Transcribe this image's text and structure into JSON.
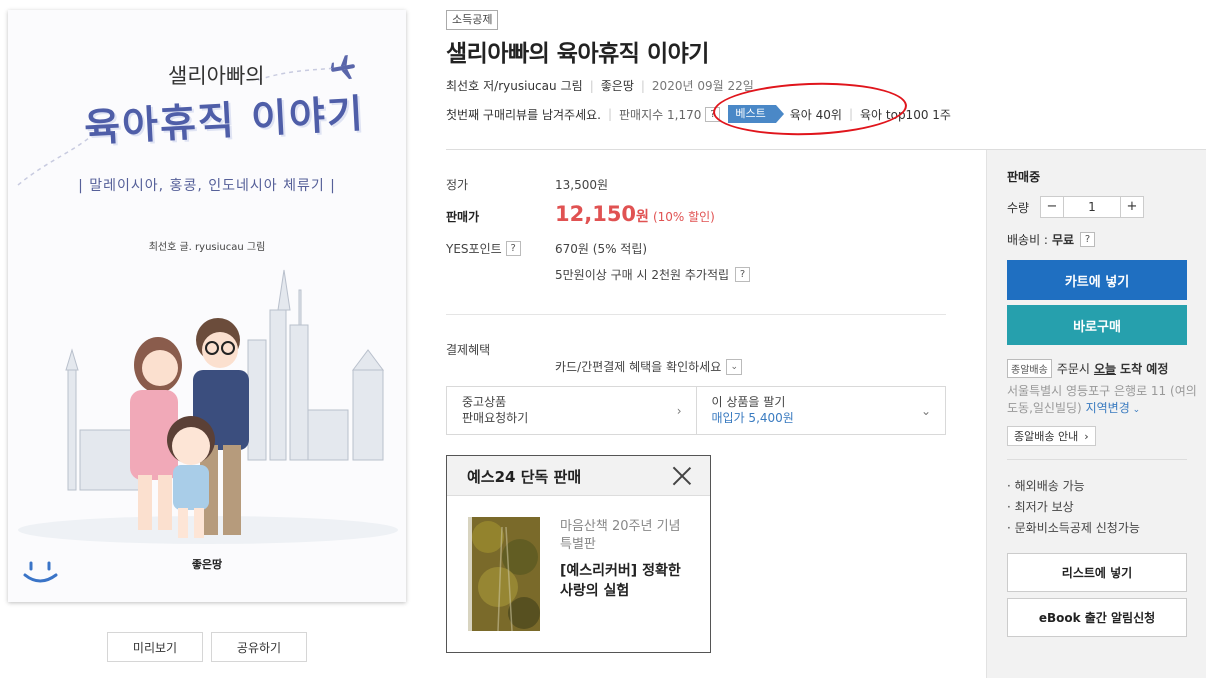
{
  "cover": {
    "subtitle_top": "샐리아빠의",
    "main_title": "육아휴직 이야기",
    "tagline": "| 말레이시아, 홍콩, 인도네시아 체류기 |",
    "authors": "최선호 글. ryusiucau 그림",
    "publisher_logo": "좋은땅"
  },
  "cover_buttons": {
    "preview": "미리보기",
    "share": "공유하기"
  },
  "product": {
    "badge": "소득공제",
    "title": "샐리아빠의 육아휴직 이야기",
    "author": "최선호",
    "author_role": "저/",
    "illustrator": "ryusiucau",
    "illustrator_role": "그림",
    "publisher": "좋은땅",
    "date": "2020년 09월 22일",
    "review_prompt": "첫번째 구매리뷰를 남겨주세요.",
    "sales_index": "판매지수 1,170",
    "best_label": "베스트",
    "rank_1": "육아 40위",
    "rank_2": "육아 top100 1주"
  },
  "price": {
    "list_label": "정가",
    "list_value": "13,500원",
    "sale_label": "판매가",
    "sale_value": "12,150",
    "sale_unit": "원",
    "discount": "(10% 할인)",
    "points_label": "YES포인트",
    "points_value": "670원 (5% 적립)",
    "bonus": "5만원이상 구매 시 2천원 추가적립",
    "pay_label": "결제혜택",
    "pay_value": "카드/간편결제 혜택을 확인하세요"
  },
  "used": {
    "left_line1": "중고상품",
    "left_line2": "판매요청하기",
    "right_line1": "이 상품을 팔기",
    "right_line2": "매입가 5,400원"
  },
  "popup": {
    "title": "예스24 단독 판매",
    "subtitle": "마음산책 20주년 기념 특별판",
    "main": "[예스리커버] 정확한 사랑의 실험"
  },
  "side": {
    "status": "판매중",
    "qty_label": "수량",
    "qty_value": "1",
    "ship_label": "배송비 :",
    "ship_value": "무료",
    "cart": "카트에 넣기",
    "buy": "바로구매",
    "delivery_tag": "종알배송",
    "delivery_text1": "주문시",
    "delivery_today": "오늘",
    "delivery_text2": "도착 예정",
    "address": "서울특별시 영등포구 은행로 11 (여의도동,일신빌딩)",
    "change_region": "지역변경",
    "guide": "종알배송 안내",
    "features": [
      "해외배송 가능",
      "최저가 보상",
      "문화비소득공제 신청가능"
    ],
    "wishlist": "리스트에 넣기",
    "ebook": "eBook 출간 알림신청"
  },
  "colors": {
    "sale_red": "#e05252",
    "cart_blue": "#1f6fc1",
    "buy_teal": "#26a0ad",
    "best_blue": "#4a88c7",
    "highlight_oval": "#e0151c"
  }
}
